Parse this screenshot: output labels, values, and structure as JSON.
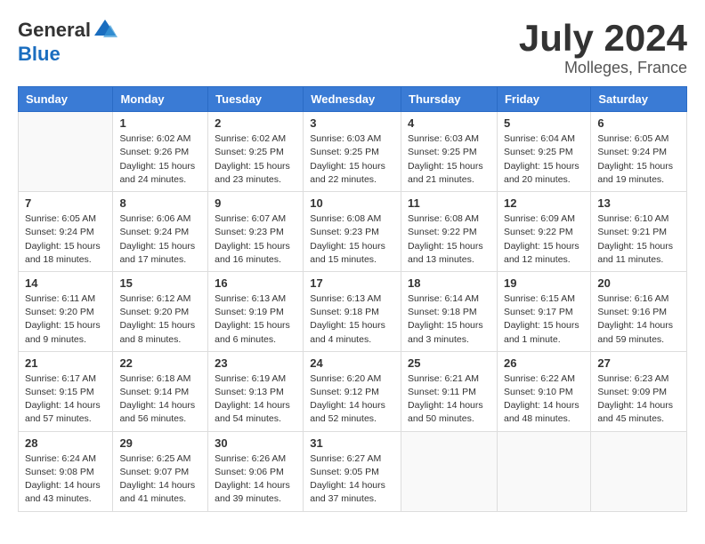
{
  "header": {
    "logo_general": "General",
    "logo_blue": "Blue",
    "month_year": "July 2024",
    "location": "Molleges, France"
  },
  "weekdays": [
    "Sunday",
    "Monday",
    "Tuesday",
    "Wednesday",
    "Thursday",
    "Friday",
    "Saturday"
  ],
  "weeks": [
    [
      {
        "day": "",
        "info": ""
      },
      {
        "day": "1",
        "info": "Sunrise: 6:02 AM\nSunset: 9:26 PM\nDaylight: 15 hours\nand 24 minutes."
      },
      {
        "day": "2",
        "info": "Sunrise: 6:02 AM\nSunset: 9:25 PM\nDaylight: 15 hours\nand 23 minutes."
      },
      {
        "day": "3",
        "info": "Sunrise: 6:03 AM\nSunset: 9:25 PM\nDaylight: 15 hours\nand 22 minutes."
      },
      {
        "day": "4",
        "info": "Sunrise: 6:03 AM\nSunset: 9:25 PM\nDaylight: 15 hours\nand 21 minutes."
      },
      {
        "day": "5",
        "info": "Sunrise: 6:04 AM\nSunset: 9:25 PM\nDaylight: 15 hours\nand 20 minutes."
      },
      {
        "day": "6",
        "info": "Sunrise: 6:05 AM\nSunset: 9:24 PM\nDaylight: 15 hours\nand 19 minutes."
      }
    ],
    [
      {
        "day": "7",
        "info": "Sunrise: 6:05 AM\nSunset: 9:24 PM\nDaylight: 15 hours\nand 18 minutes."
      },
      {
        "day": "8",
        "info": "Sunrise: 6:06 AM\nSunset: 9:24 PM\nDaylight: 15 hours\nand 17 minutes."
      },
      {
        "day": "9",
        "info": "Sunrise: 6:07 AM\nSunset: 9:23 PM\nDaylight: 15 hours\nand 16 minutes."
      },
      {
        "day": "10",
        "info": "Sunrise: 6:08 AM\nSunset: 9:23 PM\nDaylight: 15 hours\nand 15 minutes."
      },
      {
        "day": "11",
        "info": "Sunrise: 6:08 AM\nSunset: 9:22 PM\nDaylight: 15 hours\nand 13 minutes."
      },
      {
        "day": "12",
        "info": "Sunrise: 6:09 AM\nSunset: 9:22 PM\nDaylight: 15 hours\nand 12 minutes."
      },
      {
        "day": "13",
        "info": "Sunrise: 6:10 AM\nSunset: 9:21 PM\nDaylight: 15 hours\nand 11 minutes."
      }
    ],
    [
      {
        "day": "14",
        "info": "Sunrise: 6:11 AM\nSunset: 9:20 PM\nDaylight: 15 hours\nand 9 minutes."
      },
      {
        "day": "15",
        "info": "Sunrise: 6:12 AM\nSunset: 9:20 PM\nDaylight: 15 hours\nand 8 minutes."
      },
      {
        "day": "16",
        "info": "Sunrise: 6:13 AM\nSunset: 9:19 PM\nDaylight: 15 hours\nand 6 minutes."
      },
      {
        "day": "17",
        "info": "Sunrise: 6:13 AM\nSunset: 9:18 PM\nDaylight: 15 hours\nand 4 minutes."
      },
      {
        "day": "18",
        "info": "Sunrise: 6:14 AM\nSunset: 9:18 PM\nDaylight: 15 hours\nand 3 minutes."
      },
      {
        "day": "19",
        "info": "Sunrise: 6:15 AM\nSunset: 9:17 PM\nDaylight: 15 hours\nand 1 minute."
      },
      {
        "day": "20",
        "info": "Sunrise: 6:16 AM\nSunset: 9:16 PM\nDaylight: 14 hours\nand 59 minutes."
      }
    ],
    [
      {
        "day": "21",
        "info": "Sunrise: 6:17 AM\nSunset: 9:15 PM\nDaylight: 14 hours\nand 57 minutes."
      },
      {
        "day": "22",
        "info": "Sunrise: 6:18 AM\nSunset: 9:14 PM\nDaylight: 14 hours\nand 56 minutes."
      },
      {
        "day": "23",
        "info": "Sunrise: 6:19 AM\nSunset: 9:13 PM\nDaylight: 14 hours\nand 54 minutes."
      },
      {
        "day": "24",
        "info": "Sunrise: 6:20 AM\nSunset: 9:12 PM\nDaylight: 14 hours\nand 52 minutes."
      },
      {
        "day": "25",
        "info": "Sunrise: 6:21 AM\nSunset: 9:11 PM\nDaylight: 14 hours\nand 50 minutes."
      },
      {
        "day": "26",
        "info": "Sunrise: 6:22 AM\nSunset: 9:10 PM\nDaylight: 14 hours\nand 48 minutes."
      },
      {
        "day": "27",
        "info": "Sunrise: 6:23 AM\nSunset: 9:09 PM\nDaylight: 14 hours\nand 45 minutes."
      }
    ],
    [
      {
        "day": "28",
        "info": "Sunrise: 6:24 AM\nSunset: 9:08 PM\nDaylight: 14 hours\nand 43 minutes."
      },
      {
        "day": "29",
        "info": "Sunrise: 6:25 AM\nSunset: 9:07 PM\nDaylight: 14 hours\nand 41 minutes."
      },
      {
        "day": "30",
        "info": "Sunrise: 6:26 AM\nSunset: 9:06 PM\nDaylight: 14 hours\nand 39 minutes."
      },
      {
        "day": "31",
        "info": "Sunrise: 6:27 AM\nSunset: 9:05 PM\nDaylight: 14 hours\nand 37 minutes."
      },
      {
        "day": "",
        "info": ""
      },
      {
        "day": "",
        "info": ""
      },
      {
        "day": "",
        "info": ""
      }
    ]
  ]
}
